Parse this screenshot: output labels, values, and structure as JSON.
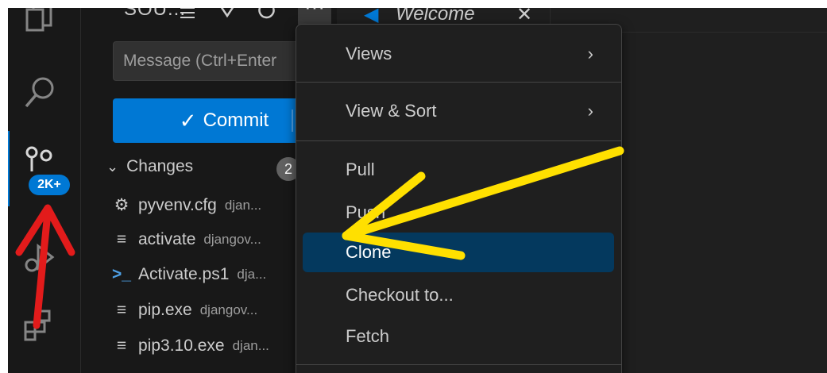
{
  "sidebar": {
    "toolbar_title": "SOU...",
    "more_label": "···",
    "message_placeholder": "Message (Ctrl+Enter",
    "commit_label": "Commit",
    "changes_label": "Changes",
    "changes_count": "2",
    "files": [
      {
        "name": "pyvenv.cfg",
        "dir": "djan...",
        "icon": "gear-icon"
      },
      {
        "name": "activate",
        "dir": "djangov...",
        "icon": "lines-icon"
      },
      {
        "name": "Activate.ps1",
        "dir": "dja...",
        "icon": "terminal-icon"
      },
      {
        "name": "pip.exe",
        "dir": "djangov...",
        "icon": "lines-icon"
      },
      {
        "name": "pip3.10.exe",
        "dir": "djan...",
        "icon": "lines-icon"
      }
    ]
  },
  "activity": {
    "scm_badge": "2K+"
  },
  "tab": {
    "label": "Welcome",
    "close": "✕"
  },
  "menu": {
    "items": [
      {
        "label": "Views",
        "submenu": true
      },
      {
        "label": "View & Sort",
        "submenu": true
      },
      {
        "label": "Pull"
      },
      {
        "label": "Push"
      },
      {
        "label": "Clone"
      },
      {
        "label": "Checkout to..."
      },
      {
        "label": "Fetch"
      }
    ]
  },
  "colors": {
    "accent": "#0078d4",
    "annotation_yellow": "#ffe000",
    "annotation_red": "#e21b1b",
    "selected": "#04395e"
  }
}
